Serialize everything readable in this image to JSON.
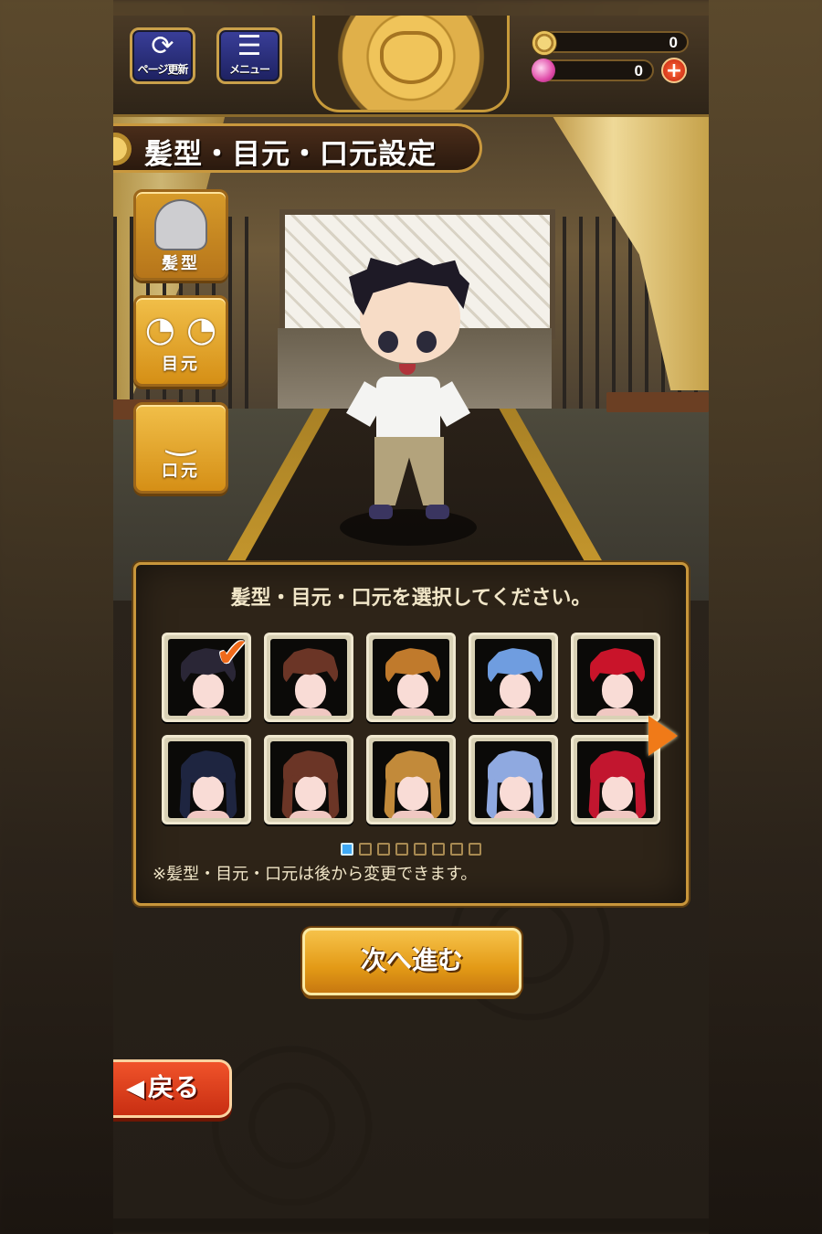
{
  "hud": {
    "refresh_label": "ページ更新",
    "menu_label": "メニュー",
    "coins": "0",
    "gems": "0",
    "plus_symbol": "+"
  },
  "title": "髪型・目元・口元設定",
  "tabs": [
    {
      "id": "hair",
      "label": "髪型",
      "icon": "hair-icon"
    },
    {
      "id": "eyes",
      "label": "目元",
      "icon": "eyes-icon"
    },
    {
      "id": "mouth",
      "label": "口元",
      "icon": "mouth-icon"
    }
  ],
  "panel": {
    "prompt": "髪型・目元・口元を選択してください。",
    "note": "※髪型・目元・口元は後から変更できます。",
    "short_hair_colors": [
      "#2a2636",
      "#6b3526",
      "#c07a2c",
      "#6f9de0",
      "#c9142a"
    ],
    "long_hair_colors": [
      "#1e2540",
      "#6b3526",
      "#c28a3a",
      "#8fa9e0",
      "#c2162f"
    ],
    "selected_index": 0,
    "page_count": 8,
    "current_page": 1
  },
  "next_button": "次へ進む",
  "back_button": "戻る",
  "colors": {
    "accent_gold": "#e39a16",
    "back_red": "#c82e12",
    "panel_border": "#c8963b"
  }
}
